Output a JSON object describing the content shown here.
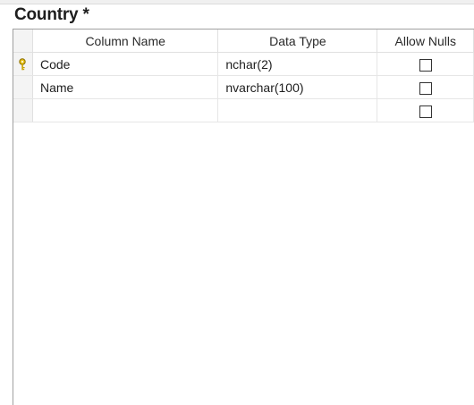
{
  "designer": {
    "title": "Country *"
  },
  "columns": {
    "col_name": "Column Name",
    "data_type": "Data Type",
    "allow_nulls": "Allow Nulls"
  },
  "rows": [
    {
      "name": "Code",
      "type": "nchar(2)",
      "allow_nulls": false,
      "primary_key": true,
      "icon": "key-icon"
    },
    {
      "name": "Name",
      "type": "nvarchar(100)",
      "allow_nulls": false,
      "primary_key": false
    },
    {
      "name": "",
      "type": "",
      "allow_nulls": false,
      "primary_key": false
    }
  ],
  "colors": {
    "key_icon": "#e8c31a"
  }
}
